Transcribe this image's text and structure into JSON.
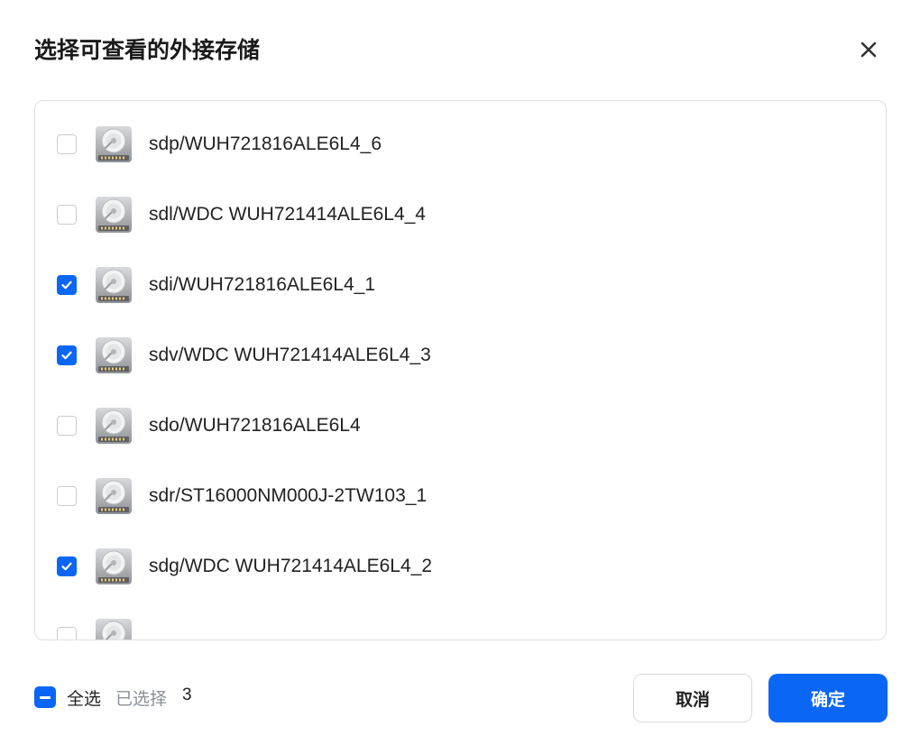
{
  "dialog": {
    "title": "选择可查看的外接存储",
    "close_icon": "close-icon"
  },
  "drives": [
    {
      "label": "sdp/WUH721816ALE6L4_6",
      "checked": false,
      "icon": "hard-drive-icon"
    },
    {
      "label": "sdl/WDC WUH721414ALE6L4_4",
      "checked": false,
      "icon": "hard-drive-icon"
    },
    {
      "label": "sdi/WUH721816ALE6L4_1",
      "checked": true,
      "icon": "hard-drive-icon"
    },
    {
      "label": "sdv/WDC WUH721414ALE6L4_3",
      "checked": true,
      "icon": "hard-drive-icon"
    },
    {
      "label": "sdo/WUH721816ALE6L4",
      "checked": false,
      "icon": "hard-drive-icon"
    },
    {
      "label": "sdr/ST16000NM000J-2TW103_1",
      "checked": false,
      "icon": "hard-drive-icon"
    },
    {
      "label": "sdg/WDC WUH721414ALE6L4_2",
      "checked": true,
      "icon": "hard-drive-icon"
    },
    {
      "label": "",
      "checked": false,
      "icon": "hard-drive-icon"
    }
  ],
  "footer": {
    "select_all_label": "全选",
    "selected_label": "已选择",
    "selected_count": "3",
    "cancel_label": "取消",
    "confirm_label": "确定"
  },
  "colors": {
    "accent": "#0a66f5",
    "border": "#dcdfe4",
    "muted_text": "#8a8f99"
  }
}
